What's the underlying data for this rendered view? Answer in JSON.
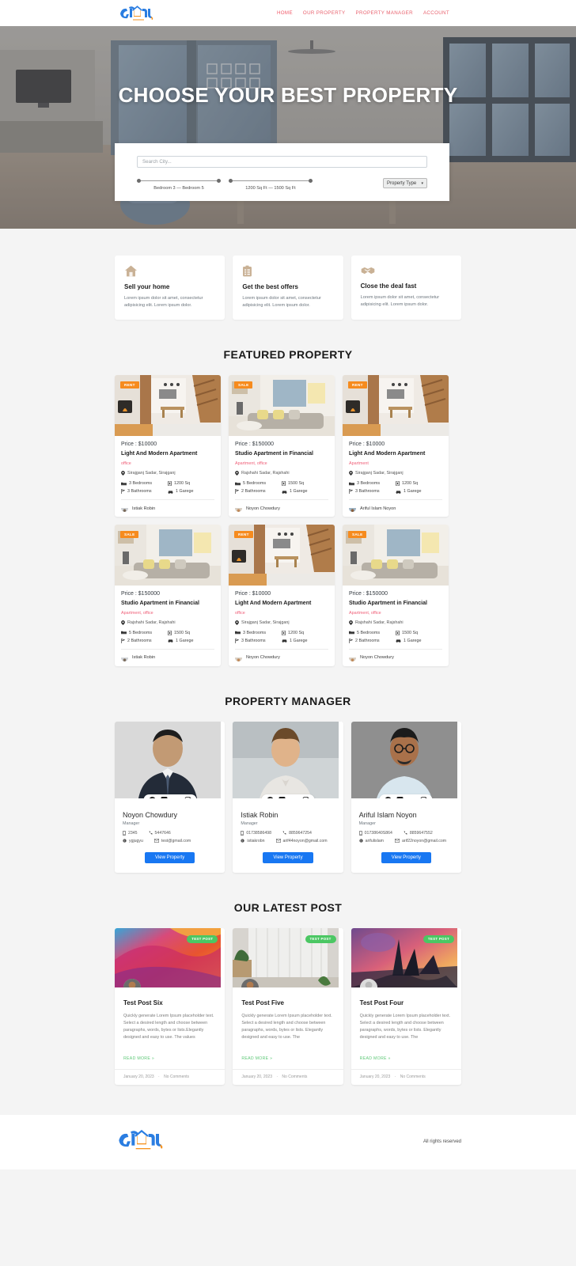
{
  "nav": {
    "logo_alt": "ghorbondhu-logo",
    "links": [
      {
        "label": "HOME"
      },
      {
        "label": "OUR PROPERTY"
      },
      {
        "label": "PROPERTY MANAGER"
      },
      {
        "label": "ACCOUNT"
      }
    ]
  },
  "hero": {
    "title": "CHOOSE YOUR BEST PROPERTY",
    "search_placeholder": "Search City...",
    "search_value": "",
    "bedroom_slider_label": "Bedroom 3 — Bedroom 5",
    "area_slider_label": "1200 Sq Ft — 1500 Sq Ft",
    "property_type_label": "Property Type"
  },
  "services": [
    {
      "icon": "home-icon",
      "title": "Sell your home",
      "text": "Lorem ipsum dolor sit amet, consectetur adipisicing elit. Lorem ipsum dolor."
    },
    {
      "icon": "clipboard-icon",
      "title": "Get the best offers",
      "text": "Lorem ipsum dolor sit amet, consectetur adipisicing elit. Lorem ipsum dolor."
    },
    {
      "icon": "handshake-icon",
      "title": "Close the deal fast",
      "text": "Lorem ipsum dolor sit amet, consectetur adipisicing elit. Lorem ipsum dolor."
    }
  ],
  "featured": {
    "section_title": "FEATURED PROPERTY",
    "properties": [
      {
        "badge": "RENT",
        "image": "interior-fireplace-stairs",
        "price": "Price : $10000",
        "name": "Light And Modern Apartment",
        "tags": "office",
        "location": "Sirajganj Sadar, Sirajganj",
        "bedrooms": "3 Bedrooms",
        "bathrooms": "3 Bathrooms",
        "area": "1200 Sq",
        "garage": "1 Garege",
        "agent": "Istiak Robin"
      },
      {
        "badge": "SALE",
        "image": "interior-living-room",
        "price": "Price : $150000",
        "name": "Studio Apartment in Financial",
        "tags": "Apartment, office",
        "location": "Rajshahi Sadar, Rajshahi",
        "bedrooms": "5 Bedrooms",
        "bathrooms": "2 Bathrooms",
        "area": "1500 Sq",
        "garage": "1 Garege",
        "agent": "Noyon Chowdury"
      },
      {
        "badge": "RENT",
        "image": "interior-fireplace-stairs",
        "price": "Price : $10000",
        "name": "Light And Modern Apartment",
        "tags": "Apartment",
        "location": "Sirajganj Sadar, Sirajganj",
        "bedrooms": "3 Bedrooms",
        "bathrooms": "3 Bathrooms",
        "area": "1200 Sq",
        "garage": "1 Garege",
        "agent": "Ariful Islam Noyon"
      },
      {
        "badge": "SALE",
        "image": "interior-living-room",
        "price": "Price : $150000",
        "name": "Studio Apartment in Financial",
        "tags": "Apartment, office",
        "location": "Rajshahi Sadar, Rajshahi",
        "bedrooms": "5 Bedrooms",
        "bathrooms": "2 Bathrooms",
        "area": "1500 Sq",
        "garage": "1 Garege",
        "agent": "Istiak Robin"
      },
      {
        "badge": "RENT",
        "image": "interior-fireplace-stairs",
        "price": "Price : $10000",
        "name": "Light And Modern Apartment",
        "tags": "office",
        "location": "Sirajganj Sadar, Sirajganj",
        "bedrooms": "3 Bedrooms",
        "bathrooms": "3 Bathrooms",
        "area": "1200 Sq",
        "garage": "1 Garege",
        "agent": "Noyon Chowdury"
      },
      {
        "badge": "SALE",
        "image": "interior-living-room",
        "price": "Price : $150000",
        "name": "Studio Apartment in Financial",
        "tags": "Apartment, office",
        "location": "Rajshahi Sadar, Rajshahi",
        "bedrooms": "5 Bedrooms",
        "bathrooms": "2 Bathrooms",
        "area": "1500 Sq",
        "garage": "1 Garege",
        "agent": "Noyon Chowdury"
      }
    ]
  },
  "managers": {
    "section_title": "PROPERTY MANAGER",
    "social_icons": [
      "facebook-icon",
      "twitter-icon",
      "linkedin-icon",
      "instagram-icon"
    ],
    "button_label": "View Property",
    "people": [
      {
        "photo": "man-in-suit",
        "name": "Noyon Chowdury",
        "role": "Manager",
        "mobile": "2345",
        "phone": "5447646",
        "skype": "ygjugyu",
        "email": "test@gmail.com"
      },
      {
        "photo": "smiling-man-sweater",
        "name": "Istiak Robin",
        "role": "Manager",
        "mobile": "01738586498",
        "phone": "8859647254",
        "skype": "istiakrobn",
        "email": "arif44noyon@gmail.com"
      },
      {
        "photo": "man-with-glasses",
        "name": "Ariful Islam Noyon",
        "role": "Manager",
        "mobile": "01738640S864",
        "phone": "8859647552",
        "skype": "arifulislam",
        "email": "arif22noyon@gmail.com"
      }
    ]
  },
  "posts": {
    "section_title": "OUR LATEST POST",
    "badge": "TEST POST",
    "read_more": "READ MORE »",
    "items": [
      {
        "image": "colorful-abstract-paint",
        "title": "Test Post Six",
        "text": "Quickly generate Lorem Ipsum placeholder text. Select a desired length and choose between paragraphs, words, bytes or lists.Elegantly designed and easy to use. The values",
        "date": "January 20, 2023",
        "comments": "No Comments"
      },
      {
        "image": "white-curtain-room",
        "title": "Test Post Five",
        "text": "Quickly generate Lorem Ipsum placeholder text. Select a desired length and choose between paragraphs, words, bytes or lists. Elegantly designed and easy to use. The",
        "date": "January 20, 2023",
        "comments": "No Comments"
      },
      {
        "image": "fantasy-shipwreck-sunset",
        "title": "Test Post Four",
        "text": "Quickly generate Lorem Ipsum placeholder text. Select a desired length and choose between paragraphs, words, bytes or lists. Elegantly designed and easy to use. The",
        "date": "January 20, 2023",
        "comments": "No Comments"
      }
    ]
  },
  "footer": {
    "logo_alt": "ghorbondhu-logo",
    "rights": "All rights reserved"
  },
  "colors": {
    "accent_pink": "#ef5f78",
    "badge_orange": "#f68b1e",
    "badge_green": "#4bc763",
    "button_blue": "#1877f2",
    "logo_blue": "#2a7de1",
    "logo_orange": "#f6921e",
    "icon_tan": "#c9b195"
  }
}
